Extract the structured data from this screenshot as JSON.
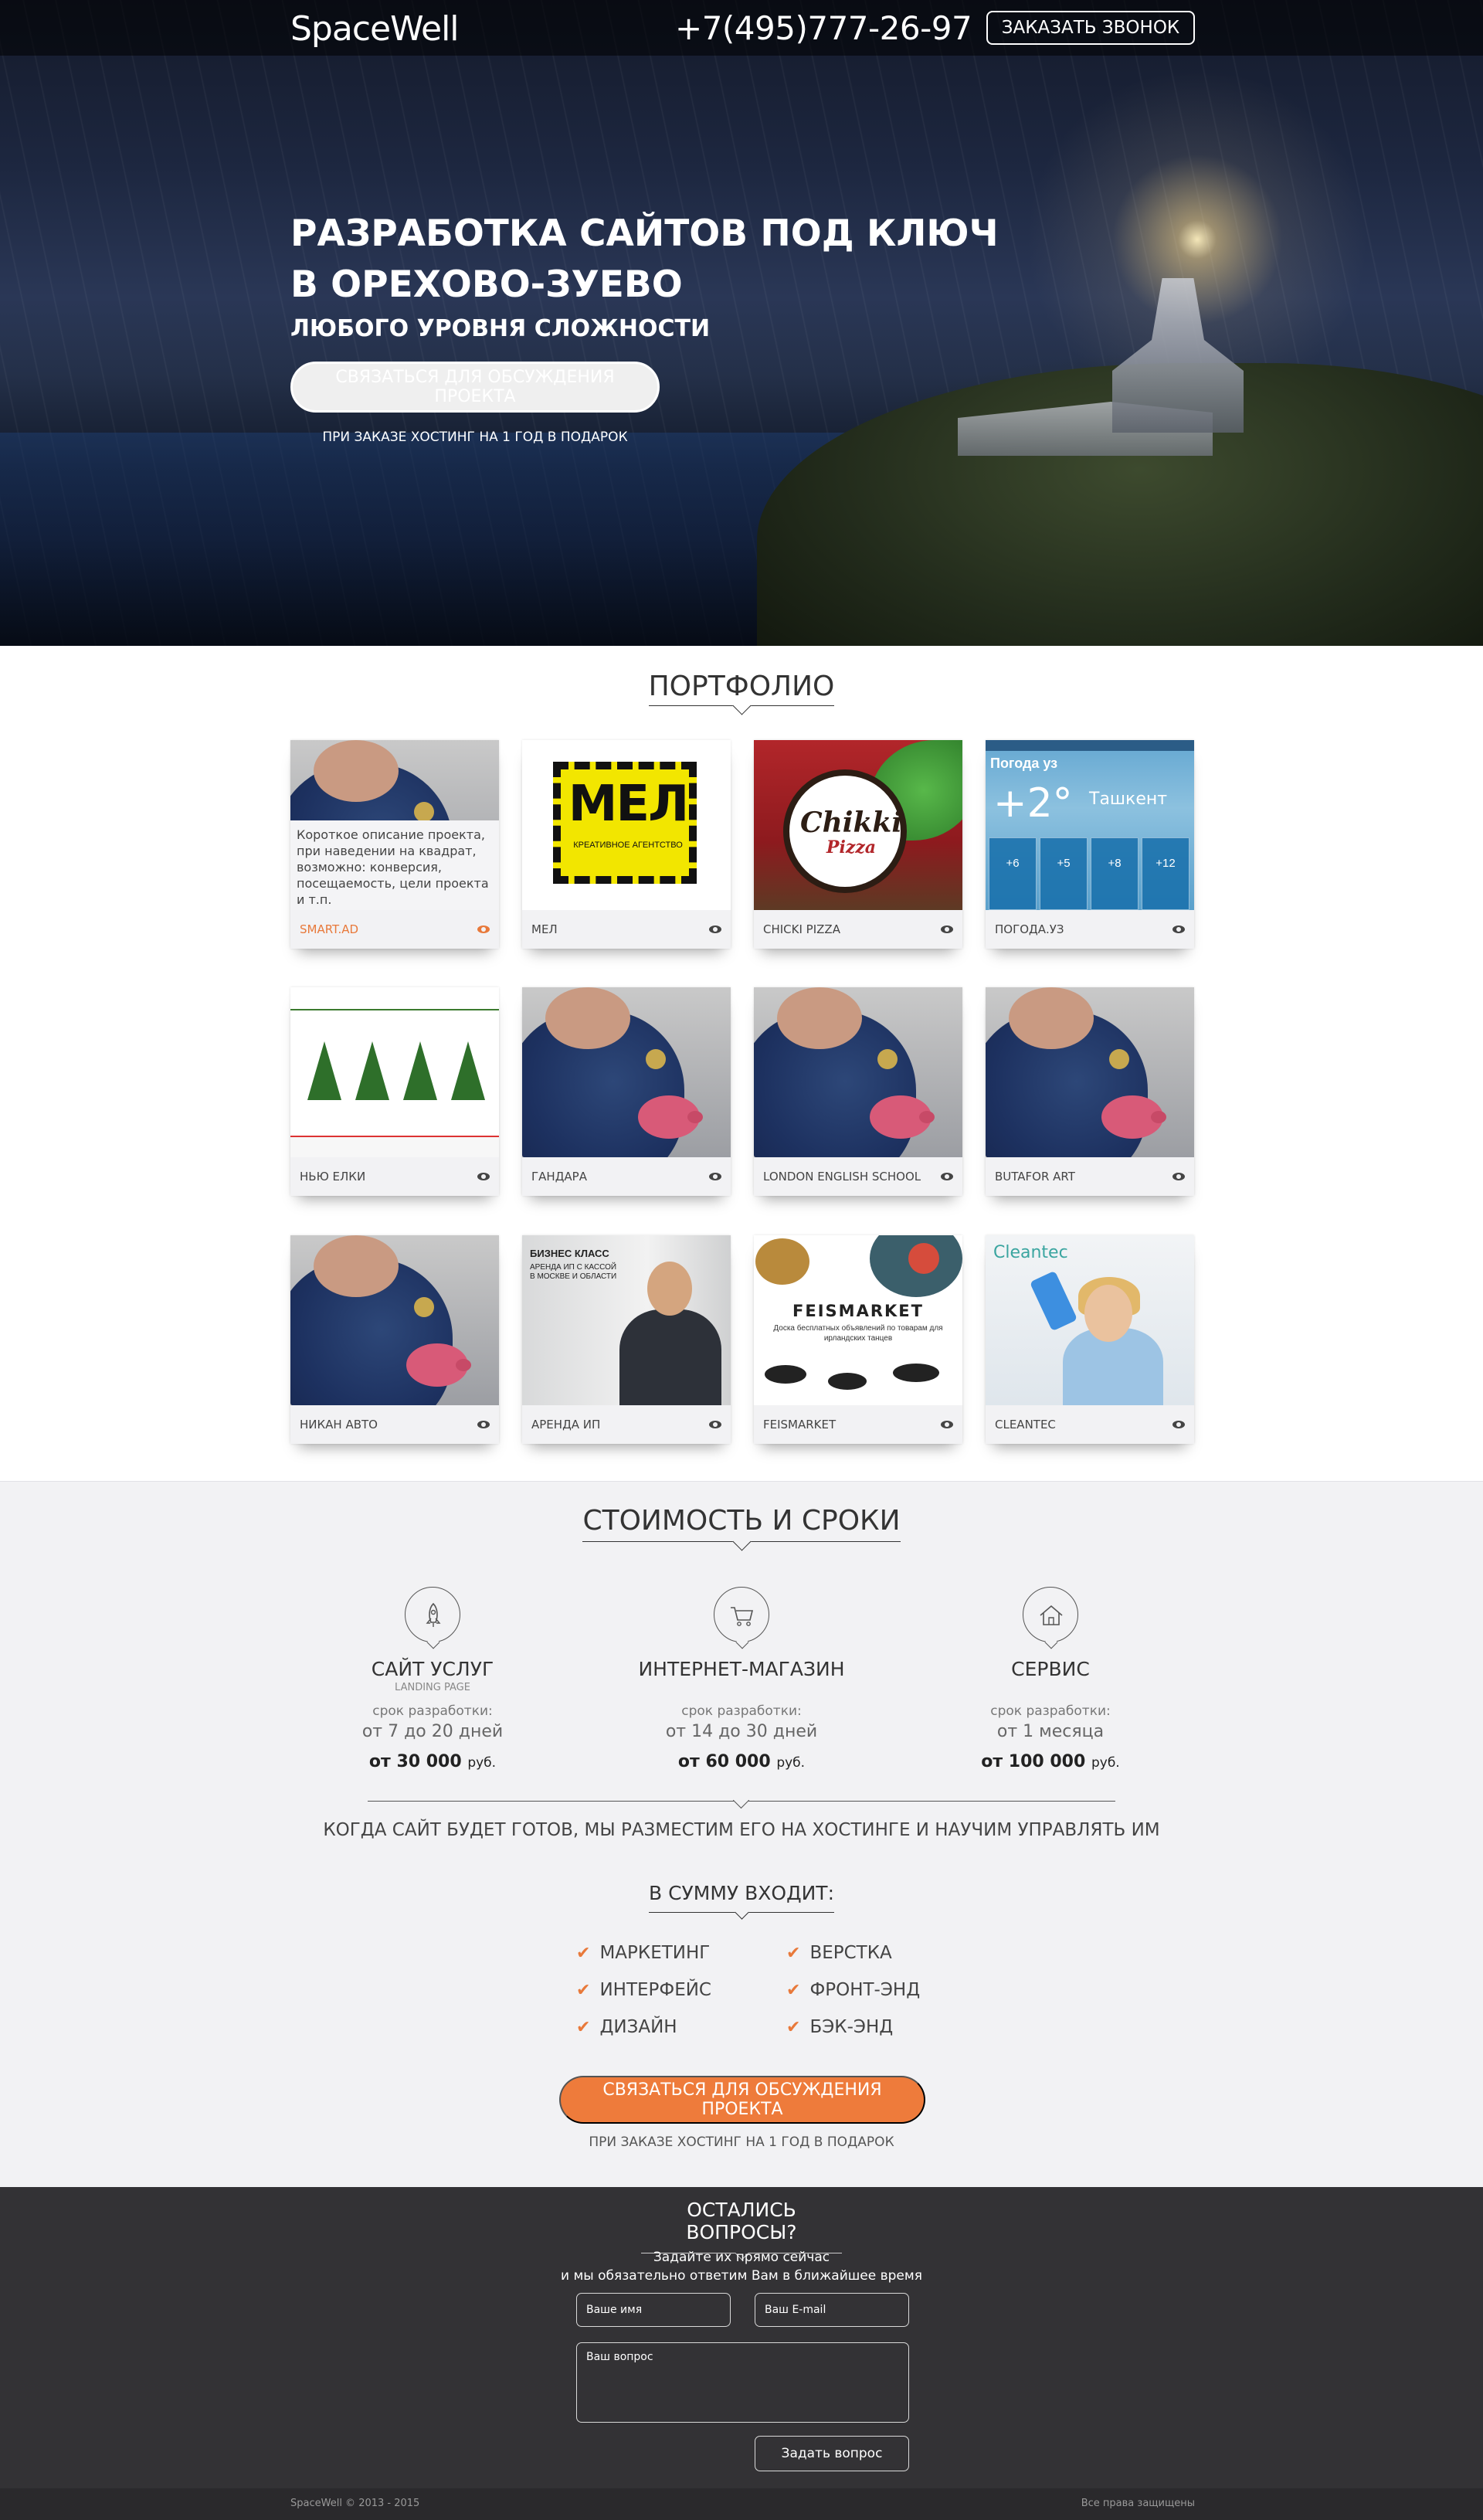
{
  "header": {
    "logo": "SpaceWell",
    "phone": "+7(495)777-26-97",
    "callback_label": "ЗАКАЗАТЬ ЗВОНОК"
  },
  "hero": {
    "title_line1": "РАЗРАБОТКА САЙТОВ ПОД КЛЮЧ",
    "title_line2": "В ОРЕХОВО-ЗУЕВО",
    "subtitle": "ЛЮБОГО УРОВНЯ СЛОЖНОСТИ",
    "cta_label": "СВЯЗАТЬСЯ ДЛЯ ОБСУЖДЕНИЯ ПРОЕКТА",
    "note": "ПРИ ЗАКАЗЕ ХОСТИНГ НА 1 ГОД В ПОДАРОК"
  },
  "portfolio": {
    "title": "ПОРТФОЛИО",
    "hover_description": "Короткое описание проекта, при наведении на квадрат, возможно: конверсия, посещаемость, цели проекта и т.п.",
    "items": [
      {
        "label": "SMART.AD"
      },
      {
        "label": "МЕЛ",
        "image_text": "МЕЛ",
        "image_subtext": "КРЕАТИВНОЕ АГЕНТСТВО"
      },
      {
        "label": "CHICKI PIZZA",
        "image_text": "Chikki",
        "image_subtext": "Pizza"
      },
      {
        "label": "ПОГОДА.УЗ",
        "image_title": "Погода уз",
        "image_temp": "+2°",
        "image_city": "Ташкент",
        "image_days": [
          "+6",
          "+5",
          "+8",
          "+12"
        ]
      },
      {
        "label": "НЬЮ ЕЛКИ"
      },
      {
        "label": "ГАНДАРА"
      },
      {
        "label": "LONDON ENGLISH SCHOOL"
      },
      {
        "label": "BUTAFOR ART"
      },
      {
        "label": "НИКАН АВТО"
      },
      {
        "label": "АРЕНДА ИП",
        "image_text": "БИЗНЕС КЛАСС",
        "image_subtext": "АРЕНДА ИП С КАССОЙ В МОСКВЕ И ОБЛАСТИ"
      },
      {
        "label": "FEISMARKET",
        "image_text": "FEISMARKET",
        "image_subtext": "Доска бесплатных объявлений по товарам для ирландских танцев"
      },
      {
        "label": "CLEANTEC",
        "image_text": "Cleantec"
      }
    ]
  },
  "pricing": {
    "title": "СТОИМОСТЬ И СРОКИ",
    "plans": [
      {
        "icon": "rocket-icon",
        "name": "САЙТ УСЛУГ",
        "small": "LANDING PAGE",
        "term_label": "срок разработки:",
        "term": "от 7 до 20 дней",
        "price": "от 30 000",
        "currency": "руб."
      },
      {
        "icon": "cart-icon",
        "name": "ИНТЕРНЕТ-МАГАЗИН",
        "small": "",
        "term_label": "срок разработки:",
        "term": "от 14 до 30 дней",
        "price": "от 60 000",
        "currency": "руб."
      },
      {
        "icon": "home-icon",
        "name": "СЕРВИС",
        "small": "",
        "term_label": "срок разработки:",
        "term": "от 1 месяца",
        "price": "от 100 000",
        "currency": "руб."
      }
    ],
    "ready_text": "КОГДА САЙТ БУДЕТ ГОТОВ, МЫ РАЗМЕСТИМ ЕГО НА ХОСТИНГЕ И НАУЧИМ УПРАВЛЯТЬ ИМ",
    "includes_title": "В СУММУ ВХОДИТ:",
    "includes": [
      "МАРКЕТИНГ",
      "ВЕРСТКА",
      "ИНТЕРФЕЙС",
      "ФРОНТ-ЭНД",
      "ДИЗАЙН",
      "БЭК-ЭНД"
    ],
    "cta_label": "СВЯЗАТЬСЯ ДЛЯ ОБСУЖДЕНИЯ ПРОЕКТА",
    "cta_note": "ПРИ ЗАКАЗЕ ХОСТИНГ НА 1 ГОД В ПОДАРОК"
  },
  "questions": {
    "title": "ОСТАЛИСЬ ВОПРОСЫ?",
    "line1": "Задайте их прямо сейчас",
    "line2": "и мы обязательно ответим Вам в ближайшее время",
    "name_placeholder": "Ваше имя",
    "email_placeholder": "Ваш E-mail",
    "question_placeholder": "Ваш вопрос",
    "submit_label": "Задать вопрос"
  },
  "footer": {
    "copyright": "SpaceWell © 2013 - 2015",
    "rights": "Все права защищены"
  },
  "colors": {
    "accent": "#ee7b3b",
    "dark_section": "#333235",
    "light_section": "#f2f2f4"
  }
}
